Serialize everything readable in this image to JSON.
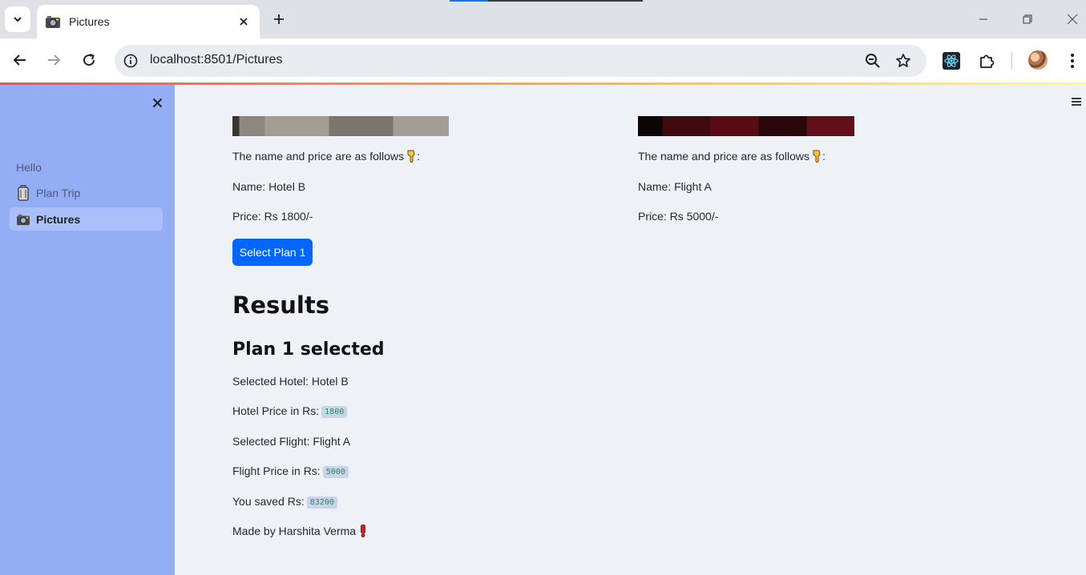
{
  "browser": {
    "tab_title": "Pictures",
    "url": "localhost:8501/Pictures"
  },
  "sidebar": {
    "section_label": "Hello",
    "items": [
      {
        "label": "Plan Trip",
        "icon": "luggage-icon",
        "active": false
      },
      {
        "label": "Pictures",
        "icon": "camera-icon",
        "active": true
      }
    ]
  },
  "cards": [
    {
      "intro": "The name and price are as follows",
      "name": "Name: Hotel B",
      "price": "Price: Rs 1800/-"
    },
    {
      "intro": "The name and price are as follows",
      "name": "Name: Flight A",
      "price": "Price: Rs 5000/-"
    }
  ],
  "select_button": "Select Plan 1",
  "results": {
    "heading": "Results",
    "subheading": "Plan 1 selected",
    "selected_hotel": "Selected Hotel: Hotel B",
    "hotel_price_label": "Hotel Price in Rs:",
    "hotel_price": "1800",
    "selected_flight": "Selected Flight: Flight A",
    "flight_price_label": "Flight Price in Rs:",
    "flight_price": "5000",
    "saved_label": "You saved Rs:",
    "saved": "83200",
    "footer": "Made by Harshita Verma"
  },
  "colors": {
    "sidebar_bg": "#94aef5",
    "primary_button": "#0266ff",
    "main_bg": "#eef1f5"
  }
}
